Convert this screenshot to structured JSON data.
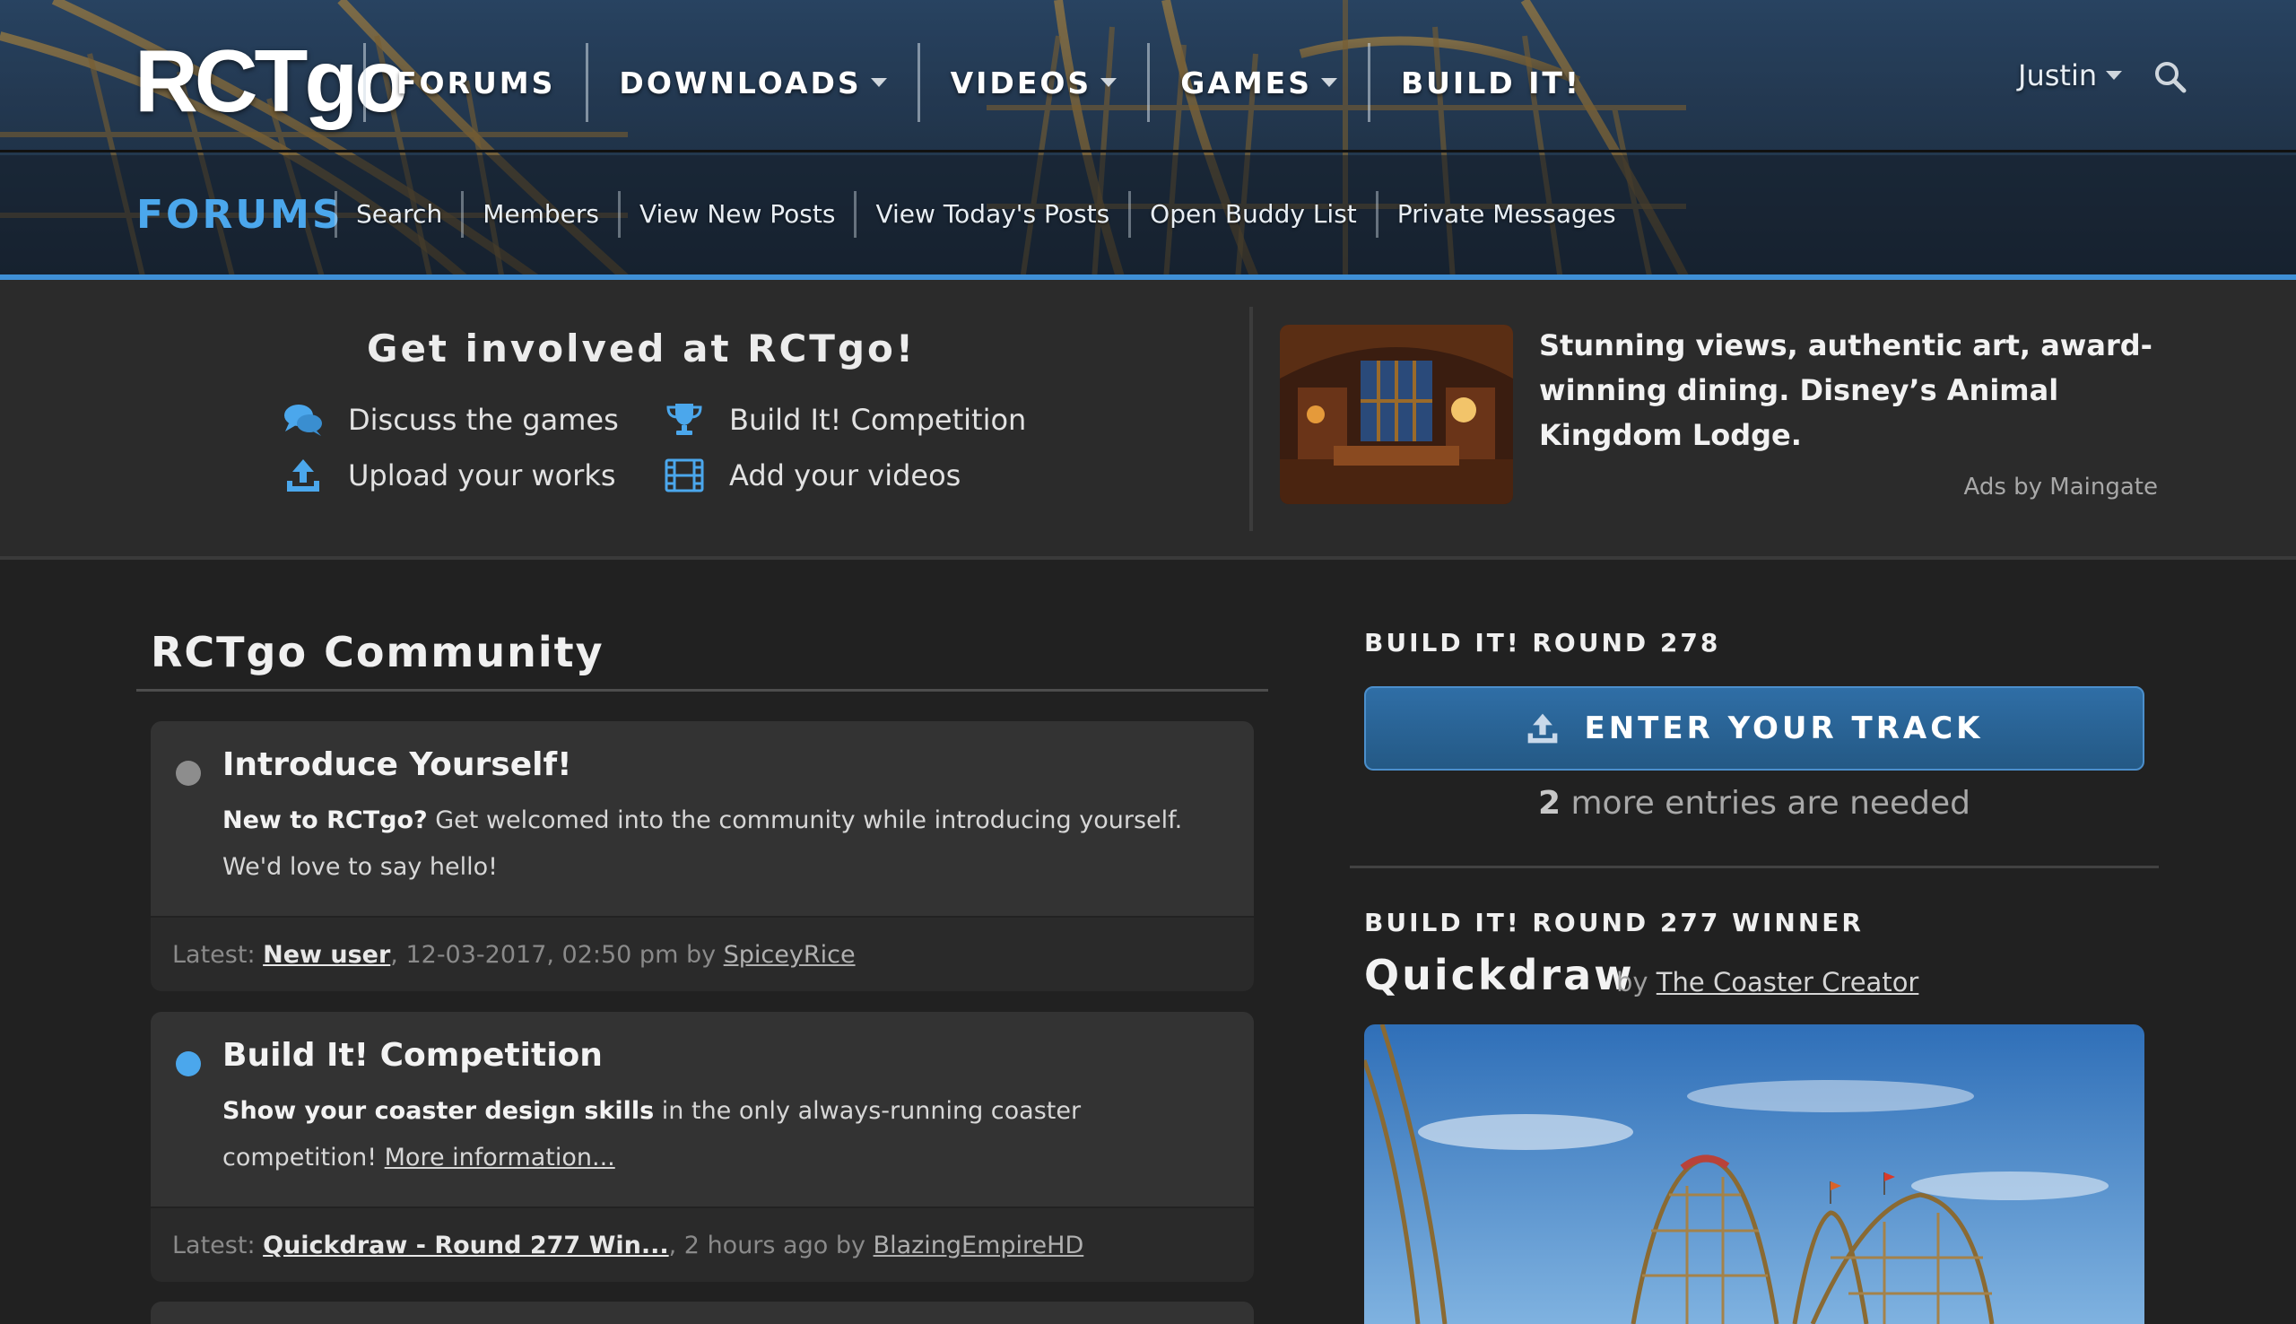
{
  "header": {
    "logo": "RCTgo",
    "nav": [
      {
        "label": "FORUMS",
        "dropdown": false
      },
      {
        "label": "DOWNLOADS",
        "dropdown": true
      },
      {
        "label": "VIDEOS",
        "dropdown": true
      },
      {
        "label": "GAMES",
        "dropdown": true
      },
      {
        "label": "BUILD IT!",
        "dropdown": false
      }
    ],
    "user": "Justin",
    "search_icon": "search-icon"
  },
  "subheader": {
    "title": "FORUMS",
    "links": [
      "Search",
      "Members",
      "View New Posts",
      "View Today's Posts",
      "Open Buddy List",
      "Private Messages"
    ]
  },
  "promo": {
    "title": "Get involved at RCTgo!",
    "items": [
      {
        "label": "Discuss the games",
        "icon": "chat-bubbles-icon"
      },
      {
        "label": "Build It! Competition",
        "icon": "trophy-icon"
      },
      {
        "label": "Upload your works",
        "icon": "upload-icon"
      },
      {
        "label": "Add your videos",
        "icon": "film-icon"
      }
    ],
    "ad": {
      "text": "Stunning views, authentic art, award-winning dining. Disney’s Animal Kingdom Lodge.",
      "credit": "Ads by Maingate"
    }
  },
  "community": {
    "title": "RCTgo Community",
    "forums": [
      {
        "name": "Introduce Yourself!",
        "desc_bold": "New to RCTgo?",
        "desc": " Get welcomed into the community while introducing yourself. We'd love to say hello!",
        "desc_link": "",
        "latest_prefix": "Latest: ",
        "latest_post": "New user",
        "latest_meta": ", 12-03-2017, 02:50 pm by ",
        "latest_user": "SpiceyRice",
        "status_color": "#8d8d8d"
      },
      {
        "name": "Build It! Competition",
        "desc_bold": "Show your coaster design skills",
        "desc": " in the only always-running coaster competition! ",
        "desc_link": "More information...",
        "latest_prefix": "Latest: ",
        "latest_post": "Quickdraw - Round 277 Win...",
        "latest_meta": ", 2 hours ago by ",
        "latest_user": "BlazingEmpireHD",
        "status_color": "#4ba7ec"
      }
    ]
  },
  "sidebar": {
    "round_label": "BUILD IT! ROUND 278",
    "enter_button": "ENTER YOUR TRACK",
    "entries_count": "2",
    "entries_text": " more entries are needed",
    "winner_label": "BUILD IT! ROUND 277 WINNER",
    "winner_name": "Quickdraw",
    "winner_by": "by ",
    "winner_author": "The Coaster Creator"
  },
  "colors": {
    "accent": "#4ba7ec",
    "background": "#212121",
    "card": "#333333",
    "button": "#2a6498"
  }
}
